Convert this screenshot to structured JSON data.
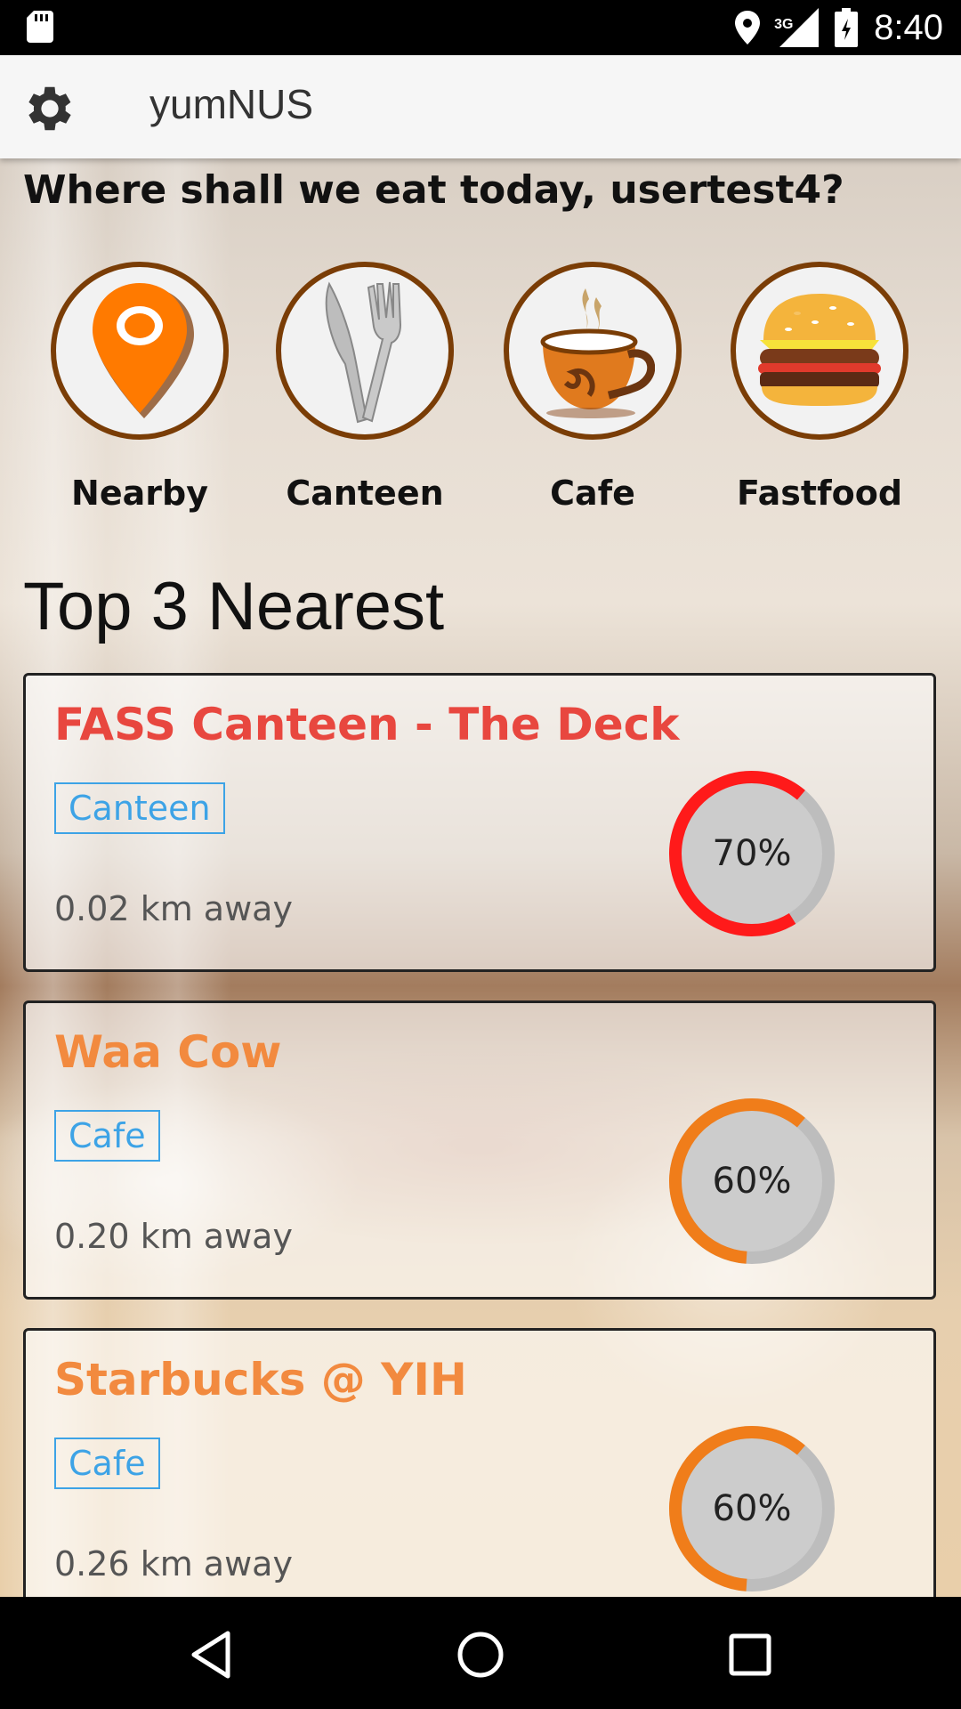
{
  "status_bar": {
    "time": "8:40",
    "network": "3G",
    "icons": [
      "sd-card-icon",
      "location-icon",
      "signal-icon",
      "battery-icon"
    ]
  },
  "app_bar": {
    "title": "yumNUS",
    "settings_icon": "gear-icon"
  },
  "greeting": "Where shall we eat today, usertest4?",
  "categories": [
    {
      "label": "Nearby",
      "icon": "location-pin-icon"
    },
    {
      "label": "Canteen",
      "icon": "fork-knife-icon"
    },
    {
      "label": "Cafe",
      "icon": "coffee-cup-icon"
    },
    {
      "label": "Fastfood",
      "icon": "burger-icon"
    }
  ],
  "section_title": "Top 3 Nearest",
  "places": [
    {
      "name": "FASS Canteen - The Deck",
      "type": "Canteen",
      "distance": "0.02 km away",
      "rating_label": "70%",
      "rating": 0.7,
      "color": "#e8473f",
      "gauge_color": "#ff1a1a"
    },
    {
      "name": "Waa Cow",
      "type": "Cafe",
      "distance": "0.20 km away",
      "rating_label": "60%",
      "rating": 0.6,
      "color": "#f28a3f",
      "gauge_color": "#f07d1a"
    },
    {
      "name": "Starbucks @ YIH",
      "type": "Cafe",
      "distance": "0.26 km away",
      "rating_label": "60%",
      "rating": 0.6,
      "color": "#f28a3f",
      "gauge_color": "#f07d1a"
    }
  ],
  "nav_bar": {
    "buttons": [
      "back-icon",
      "home-icon",
      "recents-icon"
    ]
  }
}
